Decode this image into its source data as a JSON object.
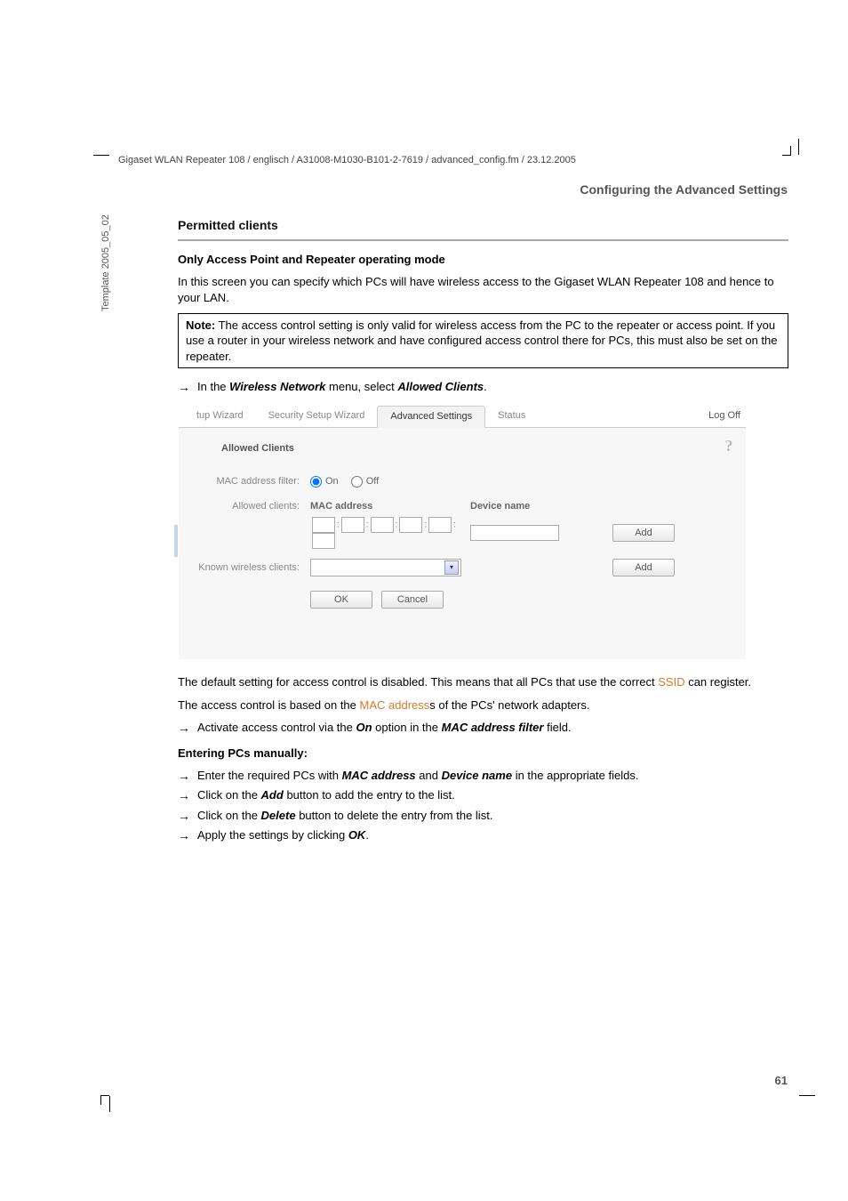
{
  "header_path": "Gigaset WLAN Repeater 108 / englisch / A31008-M1030-B101-2-7619 / advanced_config.fm / 23.12.2005",
  "section_header": "Configuring the Advanced Settings",
  "vertical_label": "Template 2005_05_02",
  "page_number": "61",
  "h_permitted": "Permitted clients",
  "p_only_mode": "Only Access Point and Repeater operating mode",
  "p_intro": "In this screen you can specify which PCs will have wireless access to the Gigaset WLAN Repeater 108 and hence to your LAN.",
  "note_title": "Note:",
  "note_body": "The access control setting is only valid for wireless access from the PC to the repeater or access point. If you use a router in your wireless network and have configured access control there for PCs, this must also be set on the repeater.",
  "arrow_menu_pre": "In the ",
  "arrow_menu_b1": "Wireless Network",
  "arrow_menu_mid": " menu, select ",
  "arrow_menu_b2": "Allowed Clients",
  "arrow_menu_post": ".",
  "ss": {
    "tab_setup": "tup Wizard",
    "tab_security": "Security Setup Wizard",
    "tab_advanced": "Advanced Settings",
    "tab_status": "Status",
    "logoff": "Log Off",
    "help": "?",
    "title": "Allowed Clients",
    "lbl_mac_filter": "MAC address filter:",
    "radio_on": "On",
    "radio_off": "Off",
    "lbl_allowed": "Allowed clients:",
    "hdr_mac": "MAC address",
    "hdr_device": "Device name",
    "btn_add": "Add",
    "lbl_known": "Known wireless clients:",
    "btn_ok": "OK",
    "btn_cancel": "Cancel"
  },
  "p_default_1": "The default setting for access control is disabled. This means that all PCs that use the correct ",
  "p_default_link": "SSID",
  "p_default_2": " can register.",
  "p_based_1": "The access control is based on the ",
  "p_based_link": "MAC address",
  "p_based_2": "s of the PCs' network adapters.",
  "arr_activate_1": "Activate access control via the ",
  "arr_activate_b1": "On",
  "arr_activate_2": " option in the ",
  "arr_activate_b2": "MAC address filter",
  "arr_activate_3": " field.",
  "h_entering": "Entering PCs manually:",
  "arr_enter_1": "Enter the required PCs with ",
  "arr_enter_b1": "MAC address",
  "arr_enter_2": " and ",
  "arr_enter_b2": "Device name",
  "arr_enter_3": " in the appropriate fields.",
  "arr_add_1": "Click on the ",
  "arr_add_b": "Add",
  "arr_add_2": " button to add the entry to the list.",
  "arr_del_1": "Click on the ",
  "arr_del_b": "Delete",
  "arr_del_2": " button to delete the entry from the list.",
  "arr_apply_1": "Apply the settings by clicking ",
  "arr_apply_b": "OK",
  "arr_apply_2": "."
}
